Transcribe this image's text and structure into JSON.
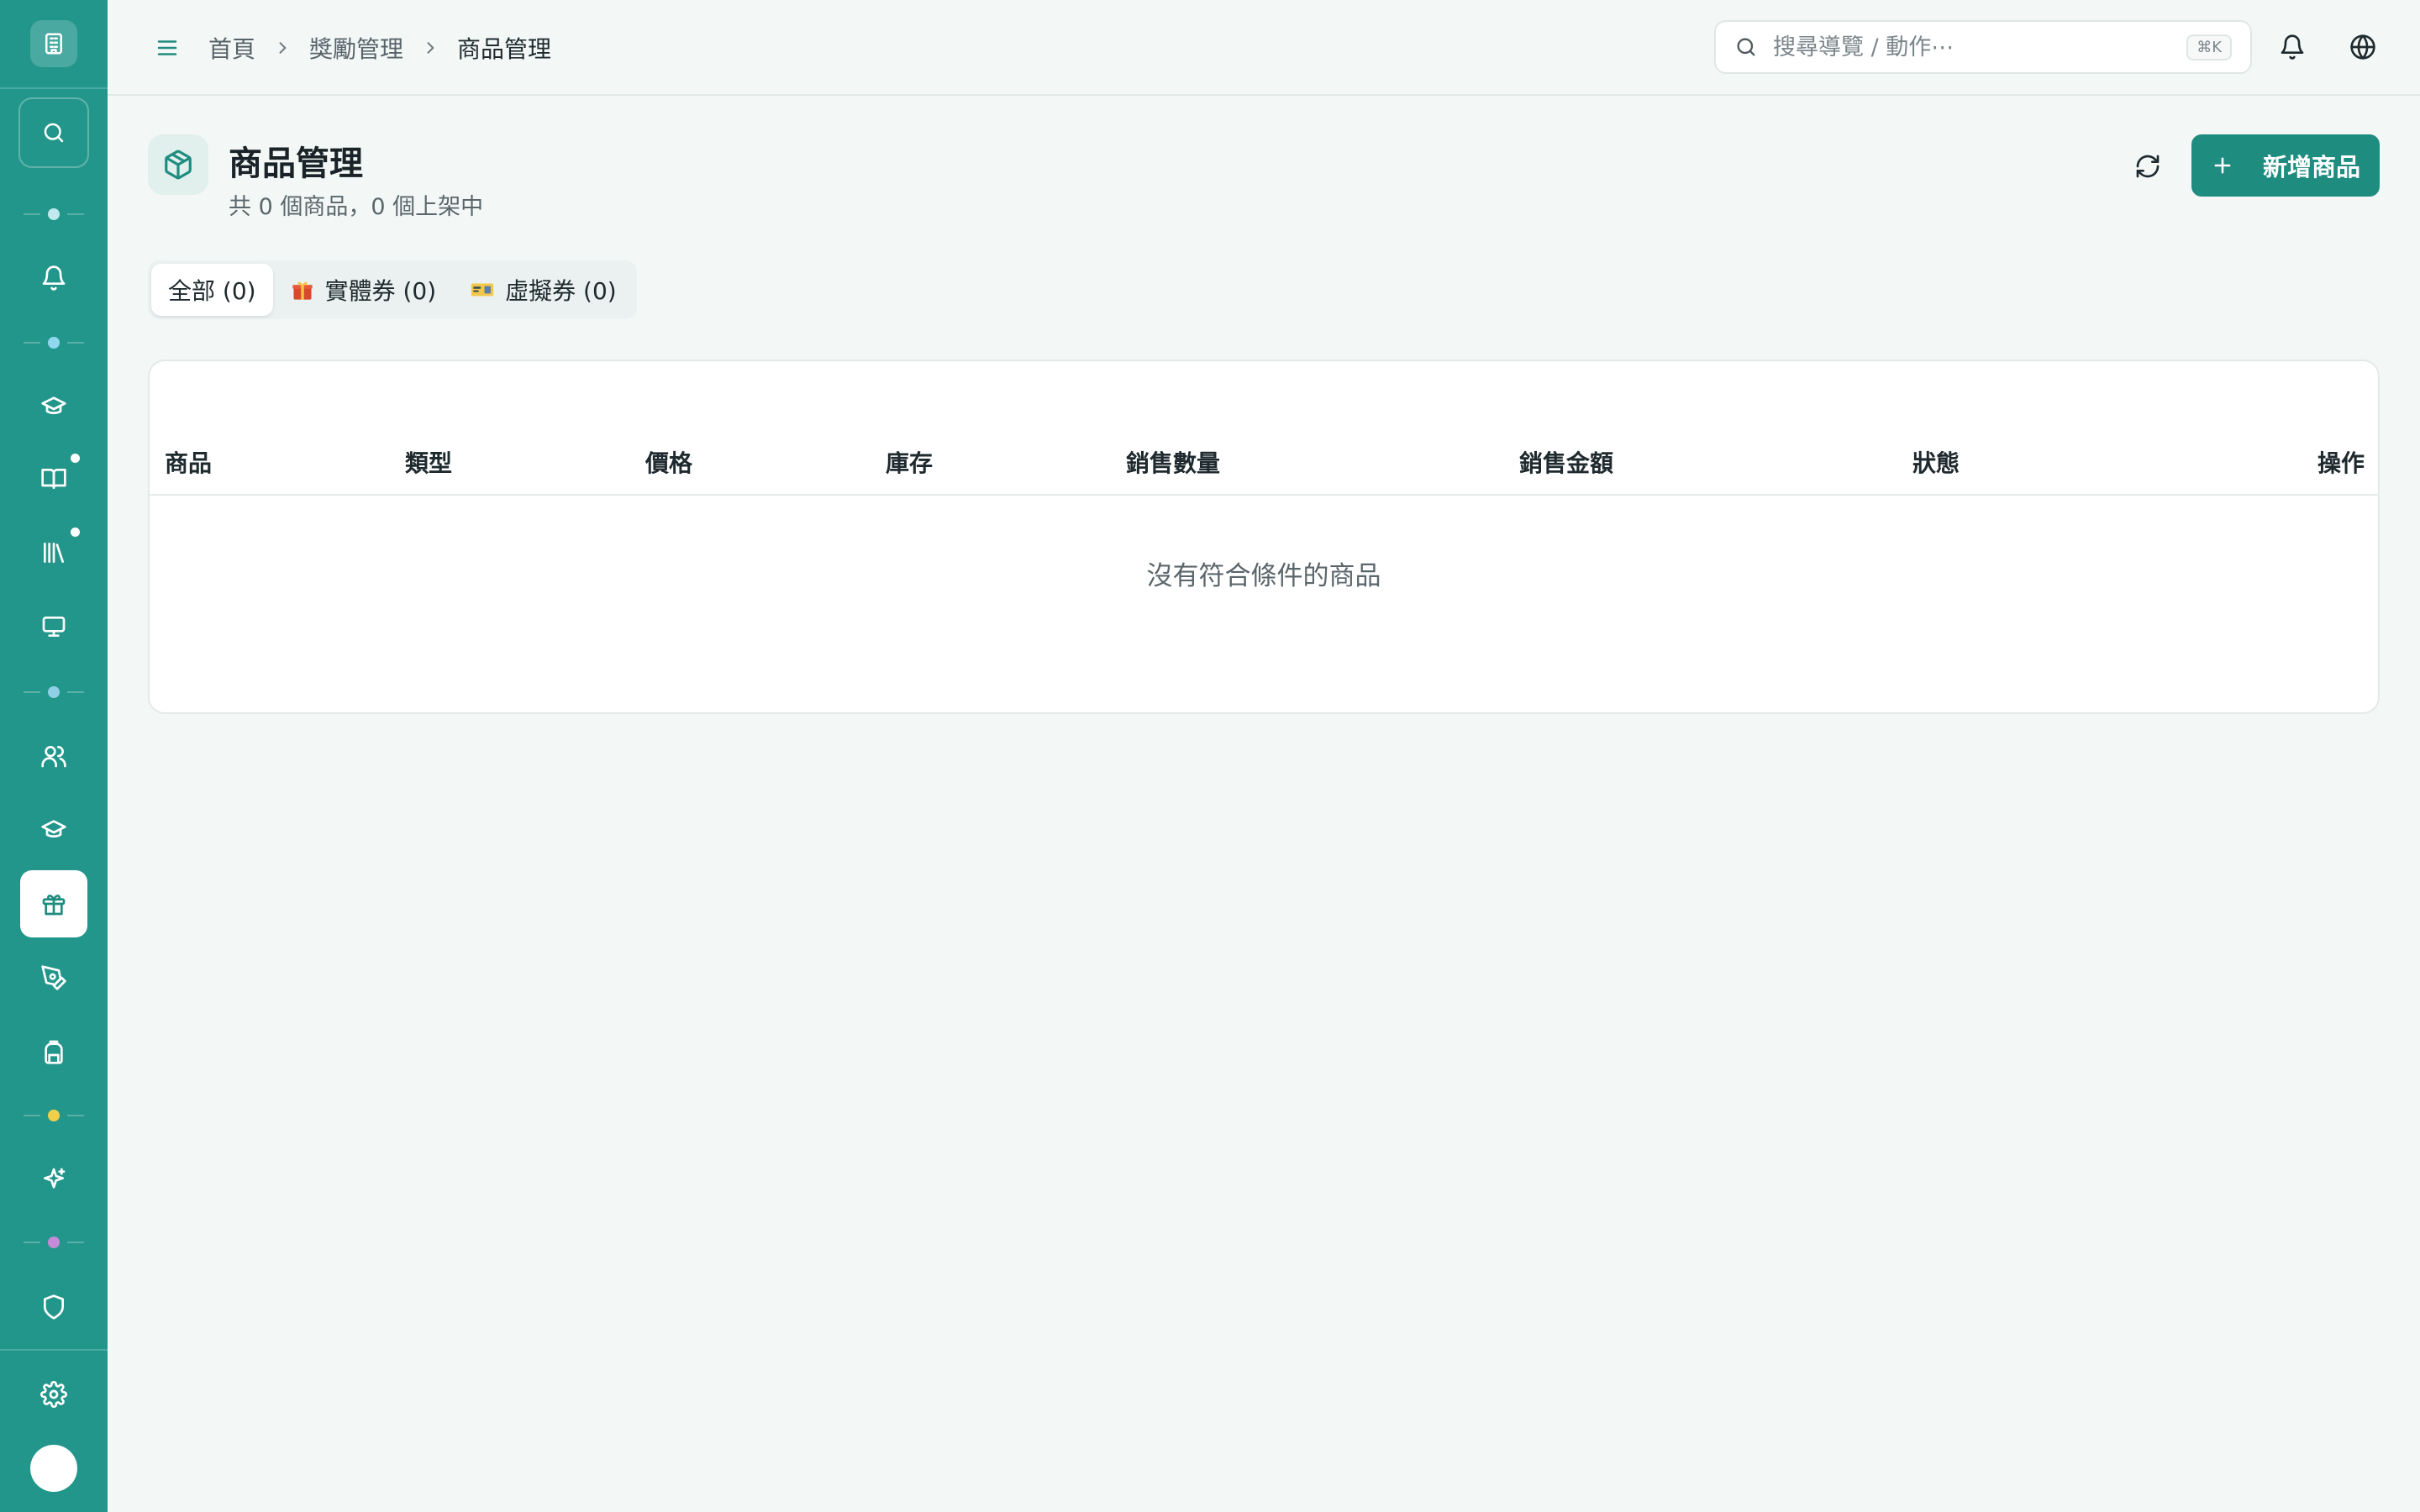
{
  "breadcrumbs": [
    "首頁",
    "獎勵管理",
    "商品管理"
  ],
  "search": {
    "placeholder": "搜尋導覽 / 動作⋯",
    "shortcut": "⌘K"
  },
  "page": {
    "title": "商品管理",
    "subtitle": "共 0 個商品，0 個上架中",
    "add_button": "新增商品"
  },
  "tabs": [
    {
      "label": "全部 (0)",
      "active": true
    },
    {
      "label": "實體券 (0)",
      "icon": "gift-icon"
    },
    {
      "label": "虛擬券 (0)",
      "icon": "ticket-icon"
    }
  ],
  "table": {
    "columns": [
      "商品",
      "類型",
      "價格",
      "庫存",
      "銷售數量",
      "銷售金額",
      "狀態",
      "操作"
    ],
    "empty_text": "沒有符合條件的商品"
  },
  "colors": {
    "sidebar": "#23968b",
    "accent": "#1f8c80",
    "background": "#f3f8f7"
  },
  "sidebar": {
    "separators": [
      {
        "dot_color": "#bfe9ee"
      },
      {
        "dot_color": "#8fd8ee"
      },
      {
        "dot_color": "#8fd0e6"
      },
      {
        "dot_color": "#f2cf4a"
      },
      {
        "dot_color": "#c58ad8"
      }
    ],
    "icons": [
      "bell-icon",
      "graduation-cap-icon",
      "book-icon",
      "library-icon",
      "monitor-icon",
      "users-icon",
      "graduation-cap-icon",
      "gift-icon",
      "pen-tool-icon",
      "backpack-icon",
      "sparkles-icon",
      "shield-icon",
      "gear-icon"
    ],
    "active_icon": "gift-icon"
  }
}
